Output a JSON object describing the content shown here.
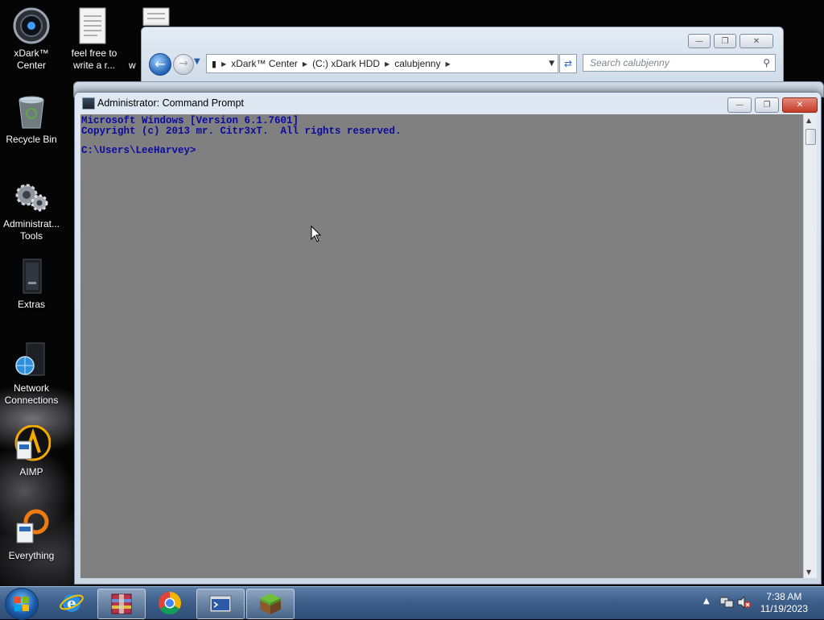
{
  "desktop": {
    "icons": [
      {
        "name": "xdark-center",
        "label_line1": "xDark™",
        "label_line2": "Center"
      },
      {
        "name": "text-file",
        "label_line1": "feel free to",
        "label_line2": "write a r..."
      },
      {
        "name": "partial-file",
        "label_line1": "w",
        "label_line2": ""
      },
      {
        "name": "recycle-bin",
        "label_line1": "Recycle Bin",
        "label_line2": ""
      },
      {
        "name": "administrative-tools",
        "label_line1": "Administrat...",
        "label_line2": "Tools"
      },
      {
        "name": "extras",
        "label_line1": "Extras",
        "label_line2": ""
      },
      {
        "name": "network-connections",
        "label_line1": "Network",
        "label_line2": "Connections"
      },
      {
        "name": "aimp",
        "label_line1": "AIMP",
        "label_line2": ""
      },
      {
        "name": "everything",
        "label_line1": "Everything",
        "label_line2": ""
      }
    ]
  },
  "explorer": {
    "address": [
      "xDark™ Center",
      "(C:) xDark HDD",
      "calubjenny"
    ],
    "search_placeholder": "Search calubjenny",
    "minimize": "—",
    "maximize": "❐",
    "close": "✕"
  },
  "cmd": {
    "title": "Administrator: Command Prompt",
    "lines": [
      "Microsoft Windows [Version 6.1.7601]",
      "Copyright (c) 2013 mr. Citr3xT.  All rights reserved.",
      "",
      "C:\\Users\\LeeHarvey>"
    ],
    "minimize": "—",
    "maximize": "❐",
    "close": "✕"
  },
  "taskbar": {
    "items": [
      "internet-explorer",
      "winrar",
      "google-chrome",
      "command-prompt",
      "minecraft"
    ],
    "clock_time": "7:38 AM",
    "clock_date": "11/19/2023"
  },
  "colors": {
    "console_bg": "#808080",
    "console_fg": "#0a0aa0",
    "taskbar": "#3d5f8a"
  }
}
